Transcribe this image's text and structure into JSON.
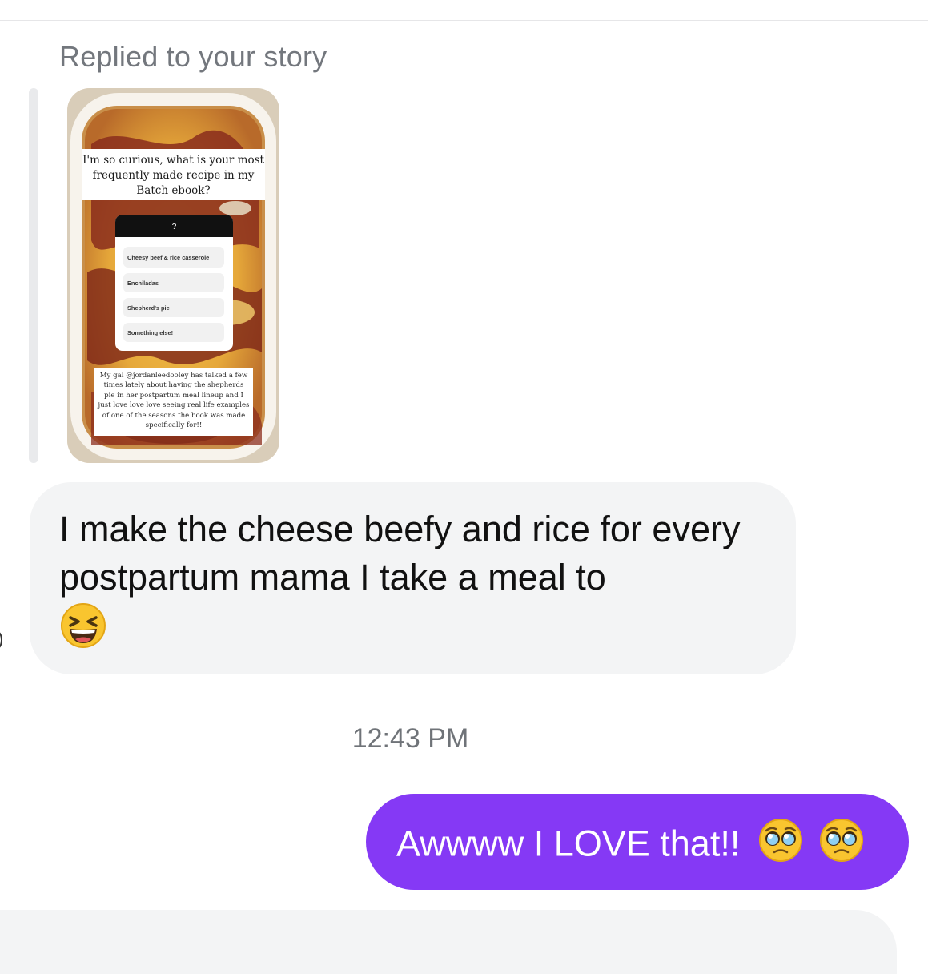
{
  "header": {
    "reply_caption": "Replied to your story"
  },
  "story": {
    "question": "I'm so curious, what is your most frequently made recipe in my Batch ebook?",
    "poll_prompt": "?",
    "poll_options": [
      "Cheesy beef & rice casserole",
      "Enchiladas",
      "Shepherd's pie",
      "Something else!"
    ],
    "caption": "My gal @jordanleedooley has talked a few times lately about having the shepherds pie in her postpartum meal lineup and I just love love love seeing real life examples of one of the seasons the book was made specifically for!!"
  },
  "received_message": {
    "text": "I make the cheese beefy and rice for every postpartum mama I take a meal to",
    "emoji": "laughing-squint-emoji"
  },
  "timestamp": "12:43 PM",
  "sent_message": {
    "text": "Awwww I LOVE that!!",
    "emojis": [
      "pleading-face-emoji",
      "pleading-face-emoji"
    ],
    "color": "#8539f5"
  },
  "colors": {
    "received_bubble": "#f3f4f5",
    "muted_text": "#73777d"
  }
}
